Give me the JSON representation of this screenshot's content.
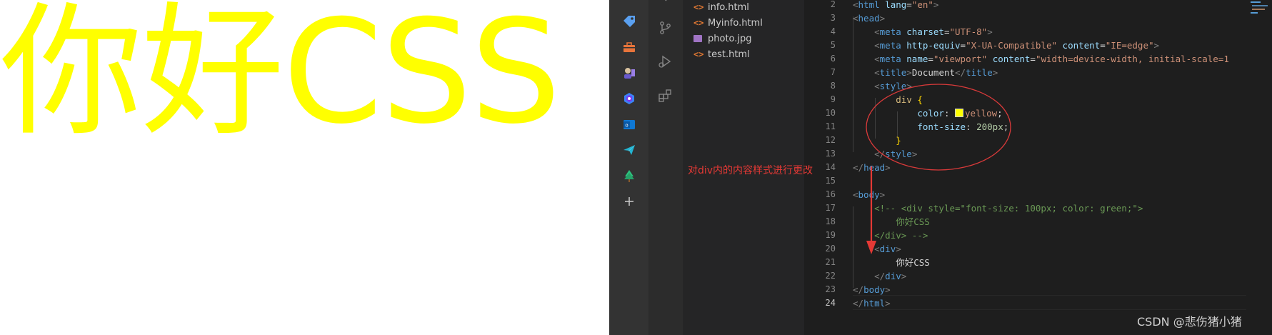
{
  "preview": {
    "text": "你好CSS",
    "color": "#ffff00"
  },
  "explorer": {
    "files": [
      {
        "name": "info.html",
        "icon": "html-file-icon"
      },
      {
        "name": "Myinfo.html",
        "icon": "html-file-icon"
      },
      {
        "name": "photo.jpg",
        "icon": "image-file-icon"
      },
      {
        "name": "test.html",
        "icon": "html-file-icon"
      }
    ]
  },
  "editor": {
    "line_numbers": [
      "2",
      "3",
      "4",
      "5",
      "6",
      "7",
      "8",
      "9",
      "10",
      "11",
      "12",
      "13",
      "14",
      "15",
      "16",
      "17",
      "18",
      "19",
      "20",
      "21",
      "22",
      "23",
      "24"
    ],
    "active_line": "24",
    "swatch_color": "#ffff00"
  },
  "annotation": {
    "text": "对div内的内容样式进行更改",
    "color": "#e53935"
  },
  "watermark": "CSDN @悲伤猪小猪",
  "theme": {
    "editor_bg": "#1e1e1e",
    "sidebar_bg": "#252526",
    "activity_bg": "#333333"
  }
}
